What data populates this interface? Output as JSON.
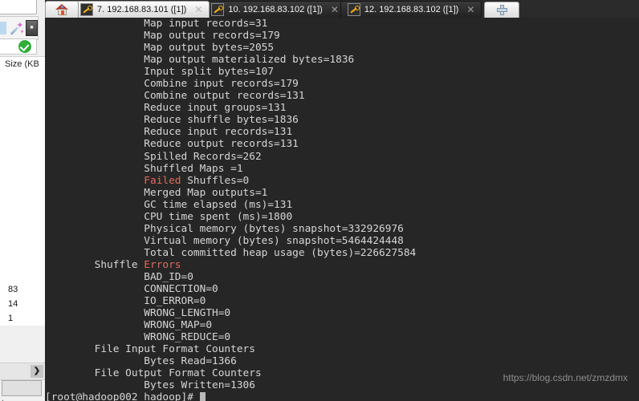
{
  "window": {
    "app_kind": "ssh-terminal-client"
  },
  "tabbar": {
    "home_tab_label": "Home",
    "add_tab_label": "+",
    "close_label": "✕",
    "tabs": [
      {
        "label": "7. 192.168.83.101 ([1])",
        "active": true
      },
      {
        "label": "10. 192.168.83.102 ([1])",
        "active": false
      },
      {
        "label": "12. 192.168.83.102 ([1])",
        "active": false
      }
    ]
  },
  "sidebar": {
    "column_header": "Size (KB",
    "values": [
      "83",
      "14",
      "1"
    ],
    "scroll_arrow": "❯",
    "footer_dot": "."
  },
  "terminal": {
    "watermark": "https://blog.csdn.net/zmzdmx",
    "prompt": "[root@hadoop002 hadoop]#",
    "lines": [
      {
        "indent": 16,
        "text": "Map input records=31"
      },
      {
        "indent": 16,
        "text": "Map output records=179"
      },
      {
        "indent": 16,
        "text": "Map output bytes=2055"
      },
      {
        "indent": 16,
        "text": "Map output materialized bytes=1836"
      },
      {
        "indent": 16,
        "text": "Input split bytes=107"
      },
      {
        "indent": 16,
        "text": "Combine input records=179"
      },
      {
        "indent": 16,
        "text": "Combine output records=131"
      },
      {
        "indent": 16,
        "text": "Reduce input groups=131"
      },
      {
        "indent": 16,
        "text": "Reduce shuffle bytes=1836"
      },
      {
        "indent": 16,
        "text": "Reduce input records=131"
      },
      {
        "indent": 16,
        "text": "Reduce output records=131"
      },
      {
        "indent": 16,
        "text": "Spilled Records=262"
      },
      {
        "indent": 16,
        "text": "Shuffled Maps =1"
      },
      {
        "indent": 16,
        "text": "Failed Shuffles=0",
        "red_prefix": "Failed"
      },
      {
        "indent": 16,
        "text": "Merged Map outputs=1"
      },
      {
        "indent": 16,
        "text": "GC time elapsed (ms)=131"
      },
      {
        "indent": 16,
        "text": "CPU time spent (ms)=1800"
      },
      {
        "indent": 16,
        "text": "Physical memory (bytes) snapshot=332926976"
      },
      {
        "indent": 16,
        "text": "Virtual memory (bytes) snapshot=5464424448"
      },
      {
        "indent": 16,
        "text": "Total committed heap usage (bytes)=226627584"
      },
      {
        "indent": 8,
        "text": "Shuffle Errors",
        "red_suffix": "Errors"
      },
      {
        "indent": 16,
        "text": "BAD_ID=0"
      },
      {
        "indent": 16,
        "text": "CONNECTION=0"
      },
      {
        "indent": 16,
        "text": "IO_ERROR=0"
      },
      {
        "indent": 16,
        "text": "WRONG_LENGTH=0"
      },
      {
        "indent": 16,
        "text": "WRONG_MAP=0"
      },
      {
        "indent": 16,
        "text": "WRONG_REDUCE=0"
      },
      {
        "indent": 8,
        "text": "File Input Format Counters"
      },
      {
        "indent": 16,
        "text": "Bytes Read=1366"
      },
      {
        "indent": 8,
        "text": "File Output Format Counters"
      },
      {
        "indent": 16,
        "text": "Bytes Written=1306"
      }
    ]
  }
}
